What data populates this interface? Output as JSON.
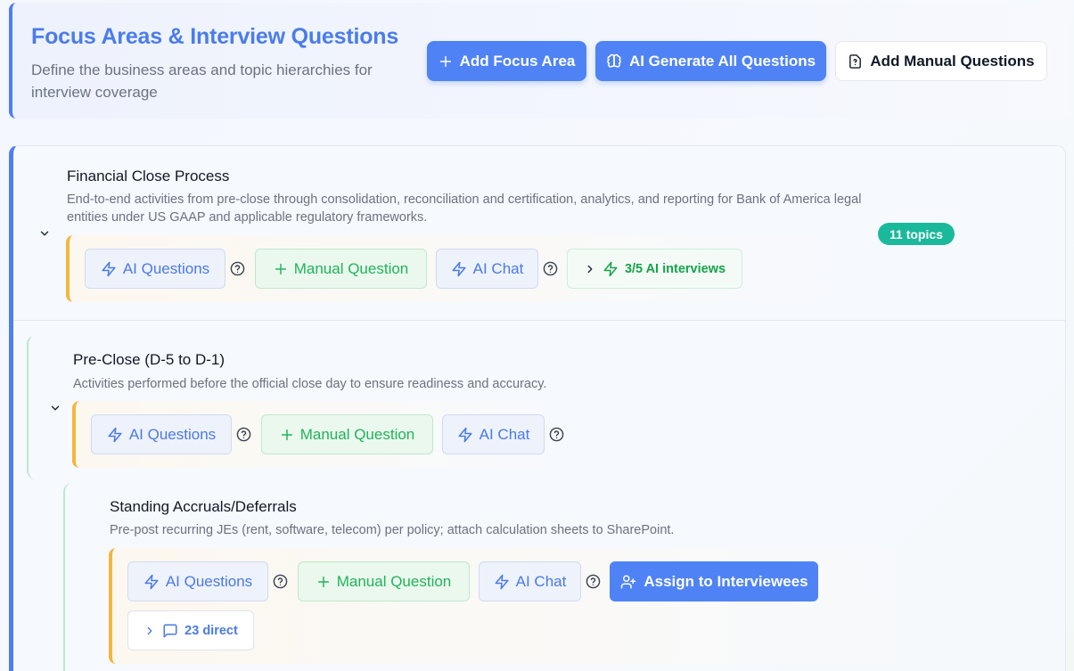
{
  "header": {
    "title": "Focus Areas & Interview Questions",
    "subtitle": "Define the business areas and topic hierarchies for interview coverage",
    "add_focus_area": "Add Focus Area",
    "ai_generate_all": "AI Generate All Questions",
    "add_manual": "Add Manual Questions"
  },
  "focus_area": {
    "title": "Financial Close Process",
    "description": "End-to-end activities from pre-close through consolidation, reconciliation and certification, analytics, and reporting for Bank of America legal entities under US GAAP and applicable regulatory frameworks.",
    "topics_badge": "11 topics",
    "ai_questions": "AI Questions",
    "manual_question": "Manual Question",
    "ai_chat": "AI Chat",
    "ai_interviews": "3/5 AI interviews"
  },
  "topic": {
    "title": "Pre-Close (D-5 to D-1)",
    "description": "Activities performed before the official close day to ensure readiness and accuracy.",
    "ai_questions": "AI Questions",
    "manual_question": "Manual Question",
    "ai_chat": "AI Chat"
  },
  "subtopic": {
    "title": "Standing Accruals/Deferrals",
    "description": "Pre-post recurring JEs (rent, software, telecom) per policy; attach calculation sheets to SharePoint.",
    "ai_questions": "AI Questions",
    "manual_question": "Manual Question",
    "ai_chat": "AI Chat",
    "assign": "Assign to Interviewees",
    "direct": "23 direct"
  },
  "colors": {
    "primary": "#4f83f5",
    "title_blue": "#4a7cec",
    "green": "#22b35a",
    "badge_teal": "#1bb99c",
    "amber_rail": "#f3b63f"
  },
  "icons": {
    "plus": "plus-icon",
    "brain": "brain-icon",
    "file_question": "file-question-icon",
    "zap": "zap-icon",
    "help": "help-circle-icon",
    "chevron_down": "chevron-down-icon",
    "chevron_right": "chevron-right-icon",
    "message": "message-square-icon",
    "user_plus": "user-plus-icon"
  }
}
